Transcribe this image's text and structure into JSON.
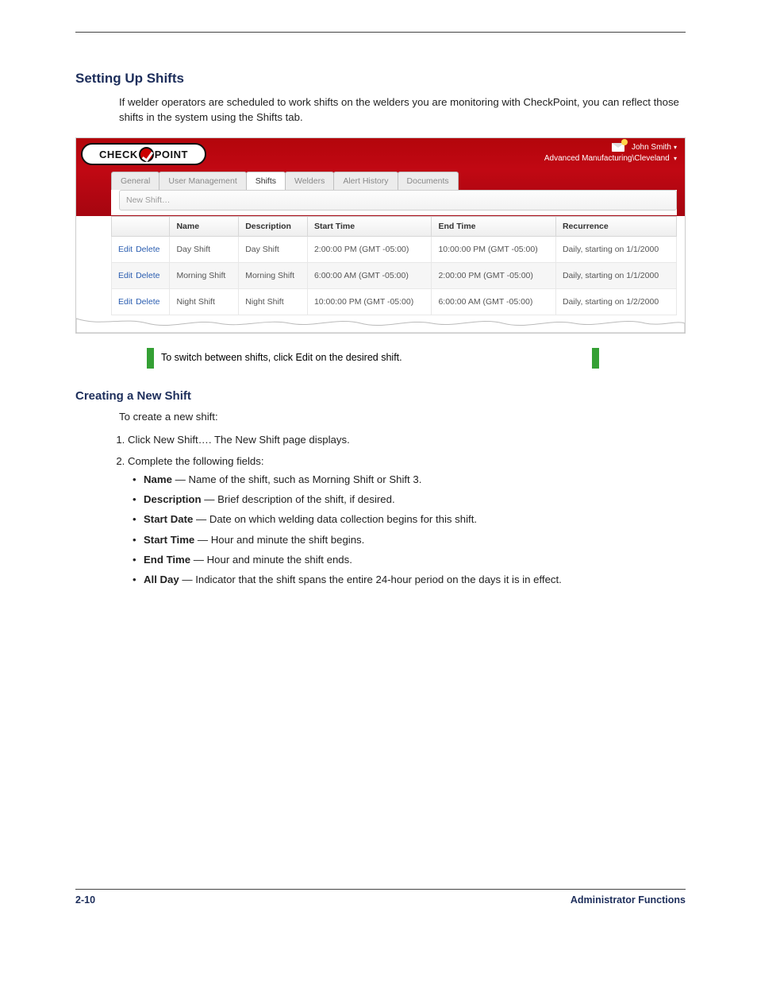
{
  "document": {
    "section_title": "Setting Up Shifts",
    "intro": "If welder operators are scheduled to work shifts on the welders you are monitoring with CheckPoint, you can reflect those shifts in the system using the Shifts tab.",
    "note_text": "To switch between shifts, click Edit on the desired shift.",
    "step_heading": "Creating a New Shift",
    "step_intro": "To create a new shift:",
    "steps": [
      "Click New Shift…. The New Shift page displays.",
      "Complete the following fields:"
    ],
    "fields": [
      {
        "label": "Name",
        "desc": "Name of the shift, such as Morning Shift or Shift 3."
      },
      {
        "label": "Description",
        "desc": "Brief description of the shift, if desired."
      },
      {
        "label": "Start Date",
        "desc": "Date on which welding data collection begins for this shift."
      },
      {
        "label": "Start Time",
        "desc": "Hour and minute the shift begins."
      },
      {
        "label": "End Time",
        "desc": "Hour and minute the shift ends."
      },
      {
        "label": "All Day",
        "desc": "Indicator that the shift spans the entire 24-hour period on the days it is in effect."
      }
    ],
    "footer_left": "2-10",
    "footer_right": "Administrator Functions"
  },
  "app": {
    "brand_left": "CHECK",
    "brand_right": "POINT",
    "user_name": "John Smith",
    "org_path": "Advanced Manufacturing\\Cleveland",
    "tabs": [
      "General",
      "User Management",
      "Shifts",
      "Welders",
      "Alert History",
      "Documents"
    ],
    "active_tab": 2,
    "new_button": "New Shift…",
    "columns": [
      "",
      "Name",
      "Description",
      "Start Time",
      "End Time",
      "Recurrence"
    ],
    "edit_label": "Edit",
    "delete_label": "Delete",
    "rows": [
      {
        "name": "Day Shift",
        "desc": "Day Shift",
        "start": "2:00:00 PM (GMT -05:00)",
        "end": "10:00:00 PM (GMT -05:00)",
        "rec": "Daily, starting on 1/1/2000"
      },
      {
        "name": "Morning Shift",
        "desc": "Morning Shift",
        "start": "6:00:00 AM (GMT -05:00)",
        "end": "2:00:00 PM (GMT -05:00)",
        "rec": "Daily, starting on 1/1/2000"
      },
      {
        "name": "Night Shift",
        "desc": "Night Shift",
        "start": "10:00:00 PM (GMT -05:00)",
        "end": "6:00:00 AM (GMT -05:00)",
        "rec": "Daily, starting on 1/2/2000"
      }
    ]
  }
}
